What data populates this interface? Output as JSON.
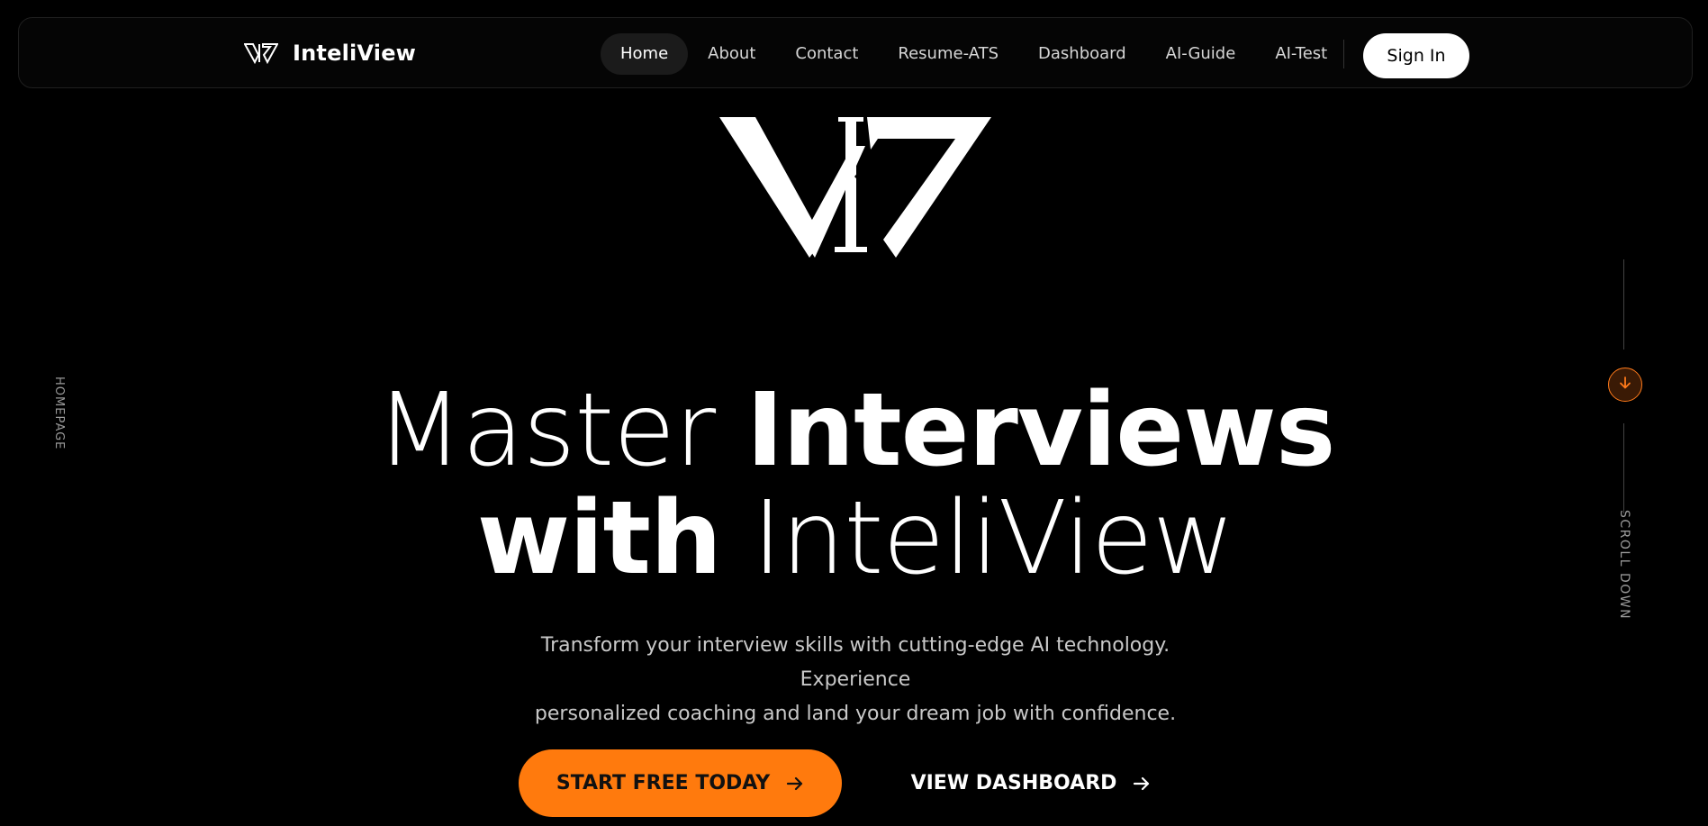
{
  "nav": {
    "brand_name": "InteliView",
    "links": [
      {
        "label": "Home",
        "active": true
      },
      {
        "label": "About"
      },
      {
        "label": "Contact"
      },
      {
        "label": "Resume-ATS"
      },
      {
        "label": "Dashboard"
      },
      {
        "label": "AI-Guide"
      },
      {
        "label": "AI-Test"
      }
    ],
    "signin_label": "Sign In"
  },
  "side": {
    "left_label": "HOMEPAGE",
    "right_label": "SCROLL DOWN"
  },
  "hero": {
    "headline_part1": "Master",
    "headline_part2": "Interviews",
    "headline_part3": "with",
    "headline_part4": "InteliView",
    "subtitle_line1": "Transform your interview skills with cutting-edge AI technology. Experience",
    "subtitle_line2": "personalized coaching and land your dream job with confidence.",
    "cta_primary": "START FREE TODAY",
    "cta_secondary": "VIEW DASHBOARD"
  },
  "colors": {
    "accent": "#ff7a0d",
    "background": "#000000",
    "text": "#ffffff"
  },
  "icons": {
    "brand": "inteliview-logo-icon",
    "scroll": "arrow-down-icon",
    "cta": "arrow-right-icon"
  }
}
